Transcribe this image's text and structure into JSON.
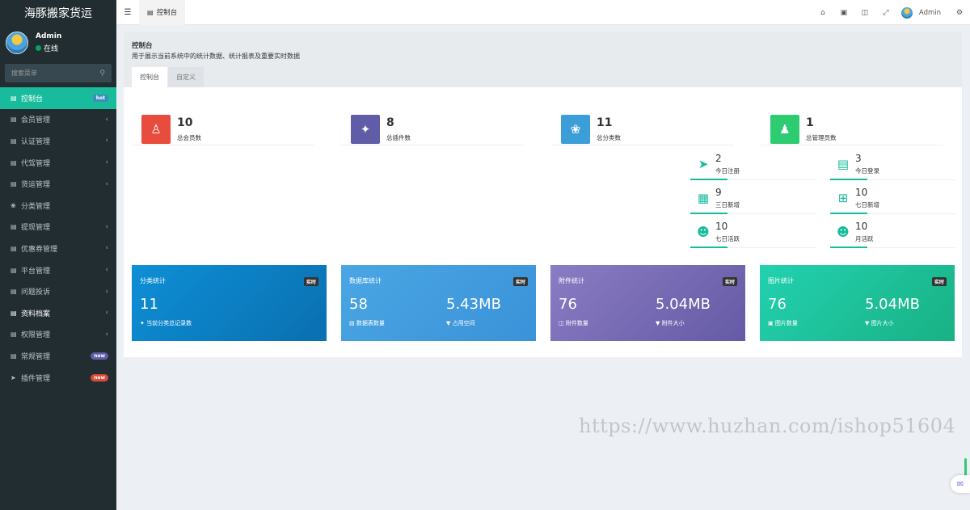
{
  "brand": "海豚搬家货运",
  "user": {
    "name": "Admin",
    "status": "在线"
  },
  "search": {
    "placeholder": "搜索菜单"
  },
  "menu": [
    {
      "label": "控制台",
      "icon": "dashboard-icon",
      "badge": "hot",
      "active": true
    },
    {
      "label": "会员管理",
      "icon": "list-icon",
      "chevron": true
    },
    {
      "label": "认证管理",
      "icon": "list-icon",
      "chevron": true
    },
    {
      "label": "代驾管理",
      "icon": "list-icon",
      "chevron": true
    },
    {
      "label": "货运管理",
      "icon": "list-icon",
      "chevron": true
    },
    {
      "label": "分类管理",
      "icon": "leaf-icon"
    },
    {
      "label": "提现管理",
      "icon": "list-icon",
      "chevron": true
    },
    {
      "label": "优惠券管理",
      "icon": "list-icon",
      "chevron": true
    },
    {
      "label": "平台管理",
      "icon": "list-icon",
      "chevron": true
    },
    {
      "label": "问题投诉",
      "icon": "list-icon",
      "chevron": true
    },
    {
      "label": "资料档案",
      "icon": "list-icon",
      "chevron": true
    },
    {
      "label": "权限管理",
      "icon": "list-icon",
      "chevron": true
    },
    {
      "label": "常规管理",
      "icon": "list-icon",
      "badge": "new"
    },
    {
      "label": "插件管理",
      "icon": "rocket-icon",
      "badge": "new"
    }
  ],
  "topnav": {
    "tab": "控制台",
    "user": "Admin"
  },
  "header": {
    "title": "控制台",
    "subtitle": "用于展示当前系统中的统计数据、统计报表及重要实时数据",
    "tabs": [
      "控制台",
      "自定义"
    ]
  },
  "stats": [
    {
      "value": "10",
      "label": "总会员数",
      "color": "#e74c3c",
      "icon": "users-icon"
    },
    {
      "value": "8",
      "label": "总插件数",
      "color": "#605ca8",
      "icon": "magic-icon"
    },
    {
      "value": "11",
      "label": "总分类数",
      "color": "#3c8dbc",
      "icon": "leaf-icon"
    },
    {
      "value": "1",
      "label": "总管理员数",
      "color": "#18bc9c",
      "icon": "user-icon"
    }
  ],
  "mini": [
    {
      "value": "2",
      "label": "今日注册",
      "icon": "rocket-icon"
    },
    {
      "value": "3",
      "label": "今日登录",
      "icon": "vcard-icon"
    },
    {
      "value": "9",
      "label": "三日新增",
      "icon": "calendar-icon"
    },
    {
      "value": "10",
      "label": "七日新增",
      "icon": "calendar-plus-icon"
    },
    {
      "value": "10",
      "label": "七日活跃",
      "icon": "user-circle-icon"
    },
    {
      "value": "10",
      "label": "月活跃",
      "icon": "user-circle-icon"
    }
  ],
  "cards": [
    {
      "title": "分类统计",
      "tag": "实时",
      "v1": "11",
      "l1": "当前分类总记录数",
      "v2": "",
      "l2": "",
      "color1": "#0e8fd6",
      "color2": "#0a6fb0"
    },
    {
      "title": "数据库统计",
      "tag": "实时",
      "v1": "58",
      "l1": "数据表数量",
      "v2": "5.43MB",
      "l2": "占用空间",
      "color1": "#4aa6e4",
      "color2": "#3a92d8"
    },
    {
      "title": "附件统计",
      "tag": "实时",
      "v1": "76",
      "l1": "附件数量",
      "v2": "5.04MB",
      "l2": "附件大小",
      "color1": "#8a7cc4",
      "color2": "#655aa5"
    },
    {
      "title": "图片统计",
      "tag": "实时",
      "v1": "76",
      "l1": "图片数量",
      "v2": "5.04MB",
      "l2": "图片大小",
      "color1": "#22d1b0",
      "color2": "#19b184"
    }
  ],
  "watermark": "https://www.huzhan.com/ishop51604"
}
